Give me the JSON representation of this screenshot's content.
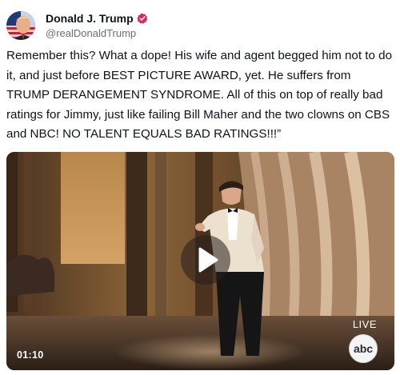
{
  "author": {
    "display_name": "Donald J. Trump",
    "handle": "@realDonaldTrump",
    "avatar_icon": "profile-avatar",
    "verified_icon": "verified-badge-icon",
    "verified_color": "#e0245e"
  },
  "post": {
    "text": "Remember this? What a dope! His wife and agent begged him not to do it, and just before BEST PICTURE AWARD, yet. He suffers from TRUMP DERANGEMENT SYNDROME. All of this on top of really bad ratings for Jimmy, just like failing Bill Maher and the two clowns on CBS and NBC! NO TALENT EQUALS BAD RATINGS!!!”"
  },
  "video": {
    "duration": "01:10",
    "live_label": "LIVE",
    "network_logo": "abc",
    "play_icon": "play-icon"
  }
}
